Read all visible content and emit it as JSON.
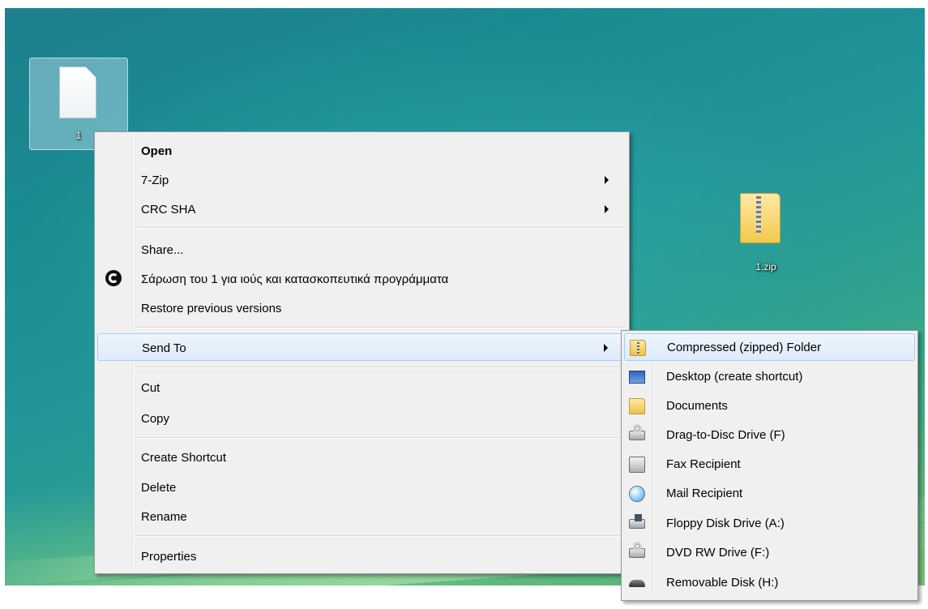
{
  "desktop": {
    "file_icon_label": "1",
    "zip_icon_label": "1.zip"
  },
  "context_menu": {
    "items": [
      {
        "label": "Open",
        "bold": true
      },
      {
        "label": "7-Zip",
        "submenu": true
      },
      {
        "label": "CRC SHA",
        "submenu": true
      },
      {
        "label": "Share..."
      },
      {
        "label": "Σάρωση του 1 για ιούς και κατασκοπευτικά προγράμματα",
        "icon": "antivirus-scan-icon"
      },
      {
        "label": "Restore previous versions"
      },
      {
        "label": "Send To",
        "submenu": true,
        "highlighted": true
      },
      {
        "label": "Cut"
      },
      {
        "label": "Copy"
      },
      {
        "label": "Create Shortcut"
      },
      {
        "label": "Delete"
      },
      {
        "label": "Rename"
      },
      {
        "label": "Properties"
      }
    ]
  },
  "sendto_submenu": {
    "items": [
      {
        "label": "Compressed (zipped) Folder",
        "icon": "zip-folder-icon",
        "highlighted": true
      },
      {
        "label": "Desktop (create shortcut)",
        "icon": "desktop-icon"
      },
      {
        "label": "Documents",
        "icon": "documents-folder-icon"
      },
      {
        "label": "Drag-to-Disc Drive (F)",
        "icon": "disc-drive-icon"
      },
      {
        "label": "Fax Recipient",
        "icon": "fax-icon"
      },
      {
        "label": "Mail Recipient",
        "icon": "mail-icon"
      },
      {
        "label": "Floppy Disk Drive (A:)",
        "icon": "floppy-drive-icon"
      },
      {
        "label": "DVD RW Drive (F:)",
        "icon": "dvd-drive-icon"
      },
      {
        "label": "Removable Disk (H:)",
        "icon": "removable-disk-icon"
      }
    ]
  }
}
